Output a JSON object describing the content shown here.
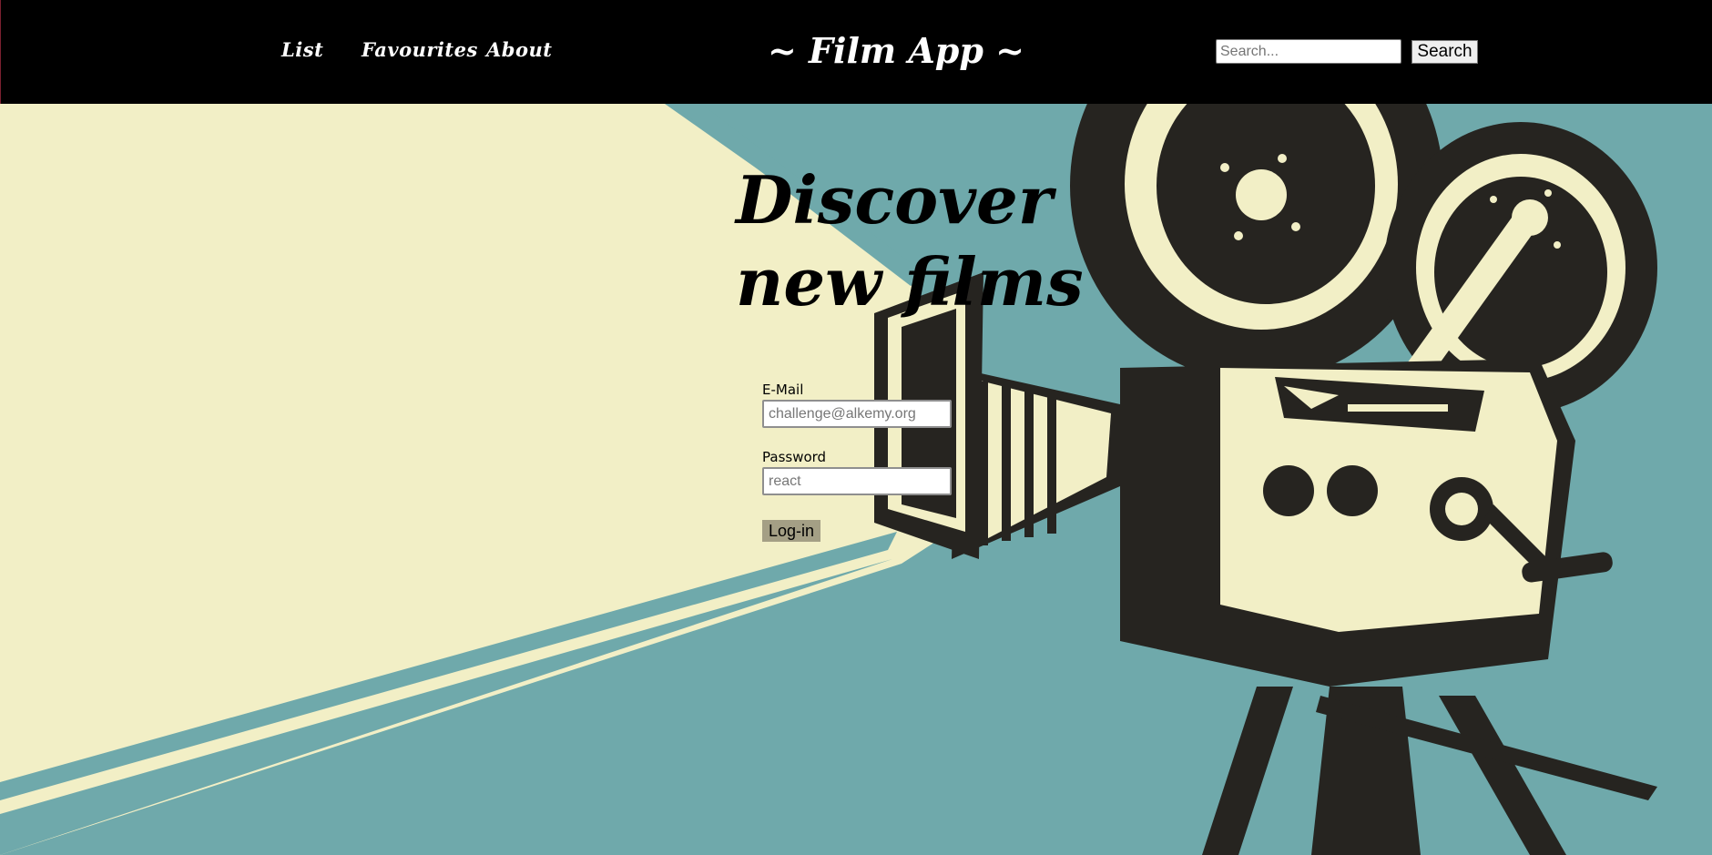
{
  "nav": {
    "links": [
      "List",
      "Favourites",
      "About"
    ],
    "brand": "~ Film App ~",
    "search_placeholder": "Search...",
    "search_button": "Search"
  },
  "hero": {
    "headline_line1": "Discover",
    "headline_line2": "new films"
  },
  "login": {
    "email_label": "E-Mail",
    "email_placeholder": "challenge@alkemy.org",
    "password_label": "Password",
    "password_placeholder": "react",
    "submit_label": "Log-in"
  },
  "colors": {
    "navbar": "#000000",
    "background_teal": "#6fa9ab",
    "cream": "#f2efc6",
    "camera_dark": "#262420",
    "login_button": "#a49f85"
  },
  "icons": {
    "background_art": "vintage-film-camera-icon"
  }
}
